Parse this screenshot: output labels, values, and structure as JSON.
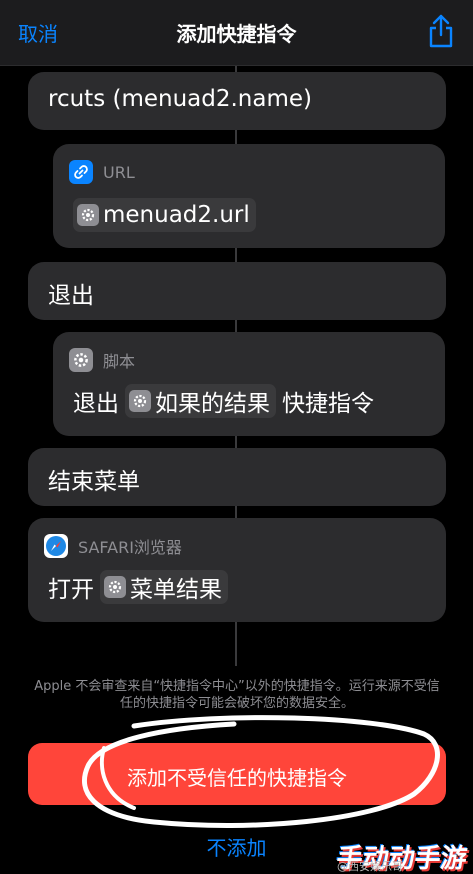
{
  "nav": {
    "cancel": "取消",
    "title": "添加快捷指令"
  },
  "actions": {
    "item1_text": "rcuts (menuad2.name)",
    "url_label": "URL",
    "url_value": "menuad2.url",
    "exit_text": "退出",
    "script_label": "脚本",
    "script_prefix": "退出",
    "script_token": "如果的结果",
    "script_suffix": "快捷指令",
    "end_menu_text": "结束菜单",
    "safari_label": "SAFARI浏览器",
    "safari_prefix": "打开",
    "safari_token": "菜单结果"
  },
  "warning": "Apple 不会审查来自“快捷指令中心”以外的快捷指令。运行来源不受信任的快捷指令可能会破坏您的数据安全。",
  "buttons": {
    "add_untrusted": "添加不受信任的快捷指令",
    "dont_add": "不添加"
  },
  "watermark": {
    "main": "手动动手游",
    "small": "@西安娱乐哥"
  },
  "colors": {
    "accent": "#0a84ff",
    "danger": "#ff453a",
    "card": "#2c2c2e"
  }
}
